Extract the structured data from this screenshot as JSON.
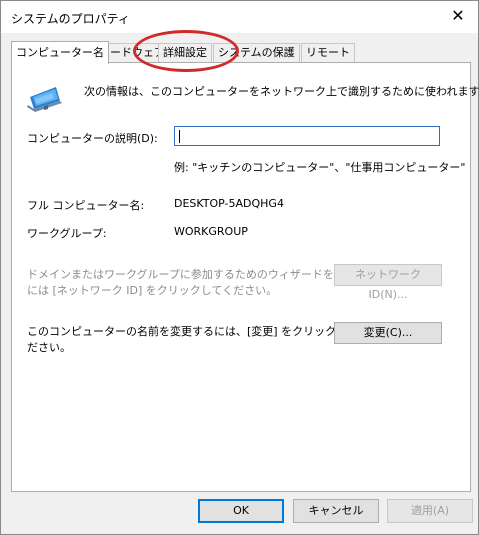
{
  "window": {
    "title": "システムのプロパティ",
    "close_glyph": "✕"
  },
  "tabs": [
    {
      "label": "コンピューター名",
      "active": true
    },
    {
      "label": "ハードウェア",
      "active": false
    },
    {
      "label": "詳細設定",
      "active": false
    },
    {
      "label": "システムの保護",
      "active": false
    },
    {
      "label": "リモート",
      "active": false
    }
  ],
  "main": {
    "intro_text": "次の情報は、このコンピューターをネットワーク上で識別するために使われます。",
    "description_label": "コンピューターの説明(D):",
    "description_value": "",
    "example_text": "例: \"キッチンのコンピューター\"、\"仕事用コンピューター\"",
    "full_name_label": "フル コンピューター名:",
    "full_name_value": "DESKTOP-5ADQHG4",
    "workgroup_label": "ワークグループ:",
    "workgroup_value": "WORKGROUP",
    "wizard_text_line1": "ドメインまたはワークグループに参加するためのウィザードを使用する",
    "wizard_text_line2": "には [ネットワーク ID] をクリックしてください。",
    "network_id_button": "ネットワーク ID(N)...",
    "rename_text_line1": "このコンピューターの名前を変更するには、[変更] をクリックしてく",
    "rename_text_line2": "ださい。",
    "change_button": "変更(C)..."
  },
  "footer": {
    "ok": "OK",
    "cancel": "キャンセル",
    "apply": "適用(A)"
  },
  "icons": {
    "computer": "computer-icon",
    "close": "close-icon"
  },
  "colors": {
    "highlight_ellipse": "#cf2b2b",
    "focus_border": "#2f6fbd",
    "default_button_border": "#0078d7"
  }
}
